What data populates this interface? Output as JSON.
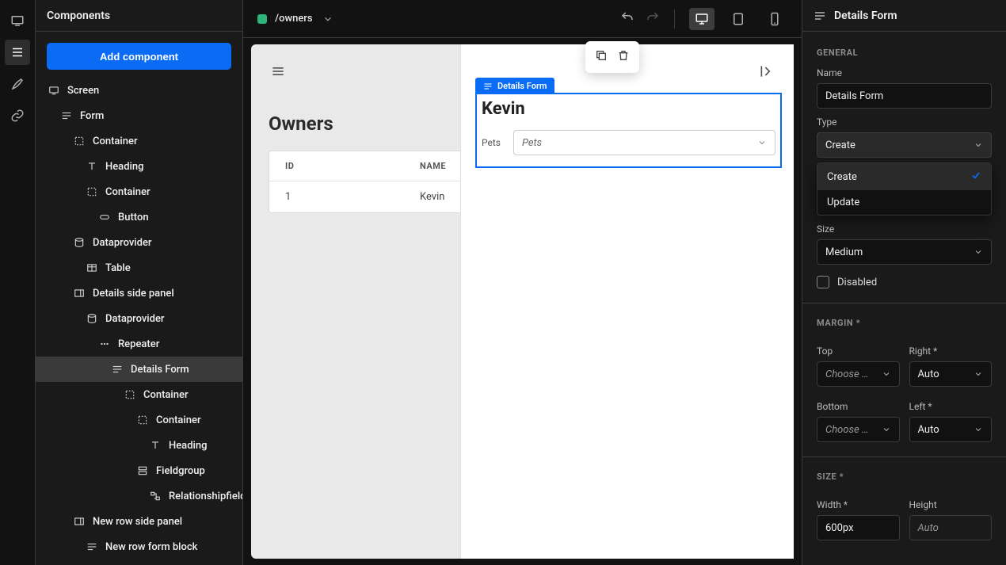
{
  "leftPanel": {
    "title": "Components",
    "addButton": "Add component",
    "tree": [
      {
        "label": "Screen",
        "indent": 0,
        "icon": "screen"
      },
      {
        "label": "Form",
        "indent": 1,
        "icon": "form"
      },
      {
        "label": "Container",
        "indent": 2,
        "icon": "container"
      },
      {
        "label": "Heading",
        "indent": 3,
        "icon": "text"
      },
      {
        "label": "Container",
        "indent": 3,
        "icon": "container"
      },
      {
        "label": "Button",
        "indent": 4,
        "icon": "button"
      },
      {
        "label": "Dataprovider",
        "indent": 2,
        "icon": "db"
      },
      {
        "label": "Table",
        "indent": 3,
        "icon": "table"
      },
      {
        "label": "Details side panel",
        "indent": 2,
        "icon": "sidepanel"
      },
      {
        "label": "Dataprovider",
        "indent": 3,
        "icon": "db"
      },
      {
        "label": "Repeater",
        "indent": 4,
        "icon": "repeater"
      },
      {
        "label": "Details Form",
        "indent": 5,
        "icon": "form",
        "selected": true
      },
      {
        "label": "Container",
        "indent": 6,
        "icon": "container"
      },
      {
        "label": "Container",
        "indent": 7,
        "icon": "container"
      },
      {
        "label": "Heading",
        "indent": 8,
        "icon": "text"
      },
      {
        "label": "Fieldgroup",
        "indent": 7,
        "icon": "fieldgroup"
      },
      {
        "label": "Relationshipfield",
        "indent": 8,
        "icon": "relationship"
      },
      {
        "label": "New row side panel",
        "indent": 2,
        "icon": "sidepanel"
      },
      {
        "label": "New row form block",
        "indent": 3,
        "icon": "form"
      }
    ]
  },
  "workspace": {
    "route": "/owners",
    "canvas": {
      "heading": "Owners",
      "table": {
        "headers": {
          "id": "ID",
          "name": "NAME"
        },
        "rows": [
          {
            "id": "1",
            "name": "Kevin"
          }
        ]
      }
    },
    "sidePanel": {
      "formTag": "Details Form",
      "heading": "Kevin",
      "petsLabel": "Pets",
      "petsPlaceholder": "Pets"
    }
  },
  "inspector": {
    "title": "Details Form",
    "sections": {
      "general": {
        "label": "GENERAL",
        "name": {
          "label": "Name",
          "value": "Details Form"
        },
        "type": {
          "label": "Type",
          "value": "Create",
          "options": [
            "Create",
            "Update"
          ],
          "selected": "Create"
        },
        "size": {
          "label": "Size",
          "value": "Medium"
        },
        "disabled": {
          "label": "Disabled"
        }
      },
      "margin": {
        "label": "MARGIN *",
        "top": {
          "label": "Top",
          "value": "Choose …"
        },
        "right": {
          "label": "Right *",
          "value": "Auto"
        },
        "bottom": {
          "label": "Bottom",
          "value": "Choose …"
        },
        "left": {
          "label": "Left *",
          "value": "Auto"
        }
      },
      "size": {
        "label": "SIZE *",
        "width": {
          "label": "Width *",
          "value": "600px"
        },
        "height": {
          "label": "Height",
          "value": "Auto"
        }
      }
    }
  }
}
